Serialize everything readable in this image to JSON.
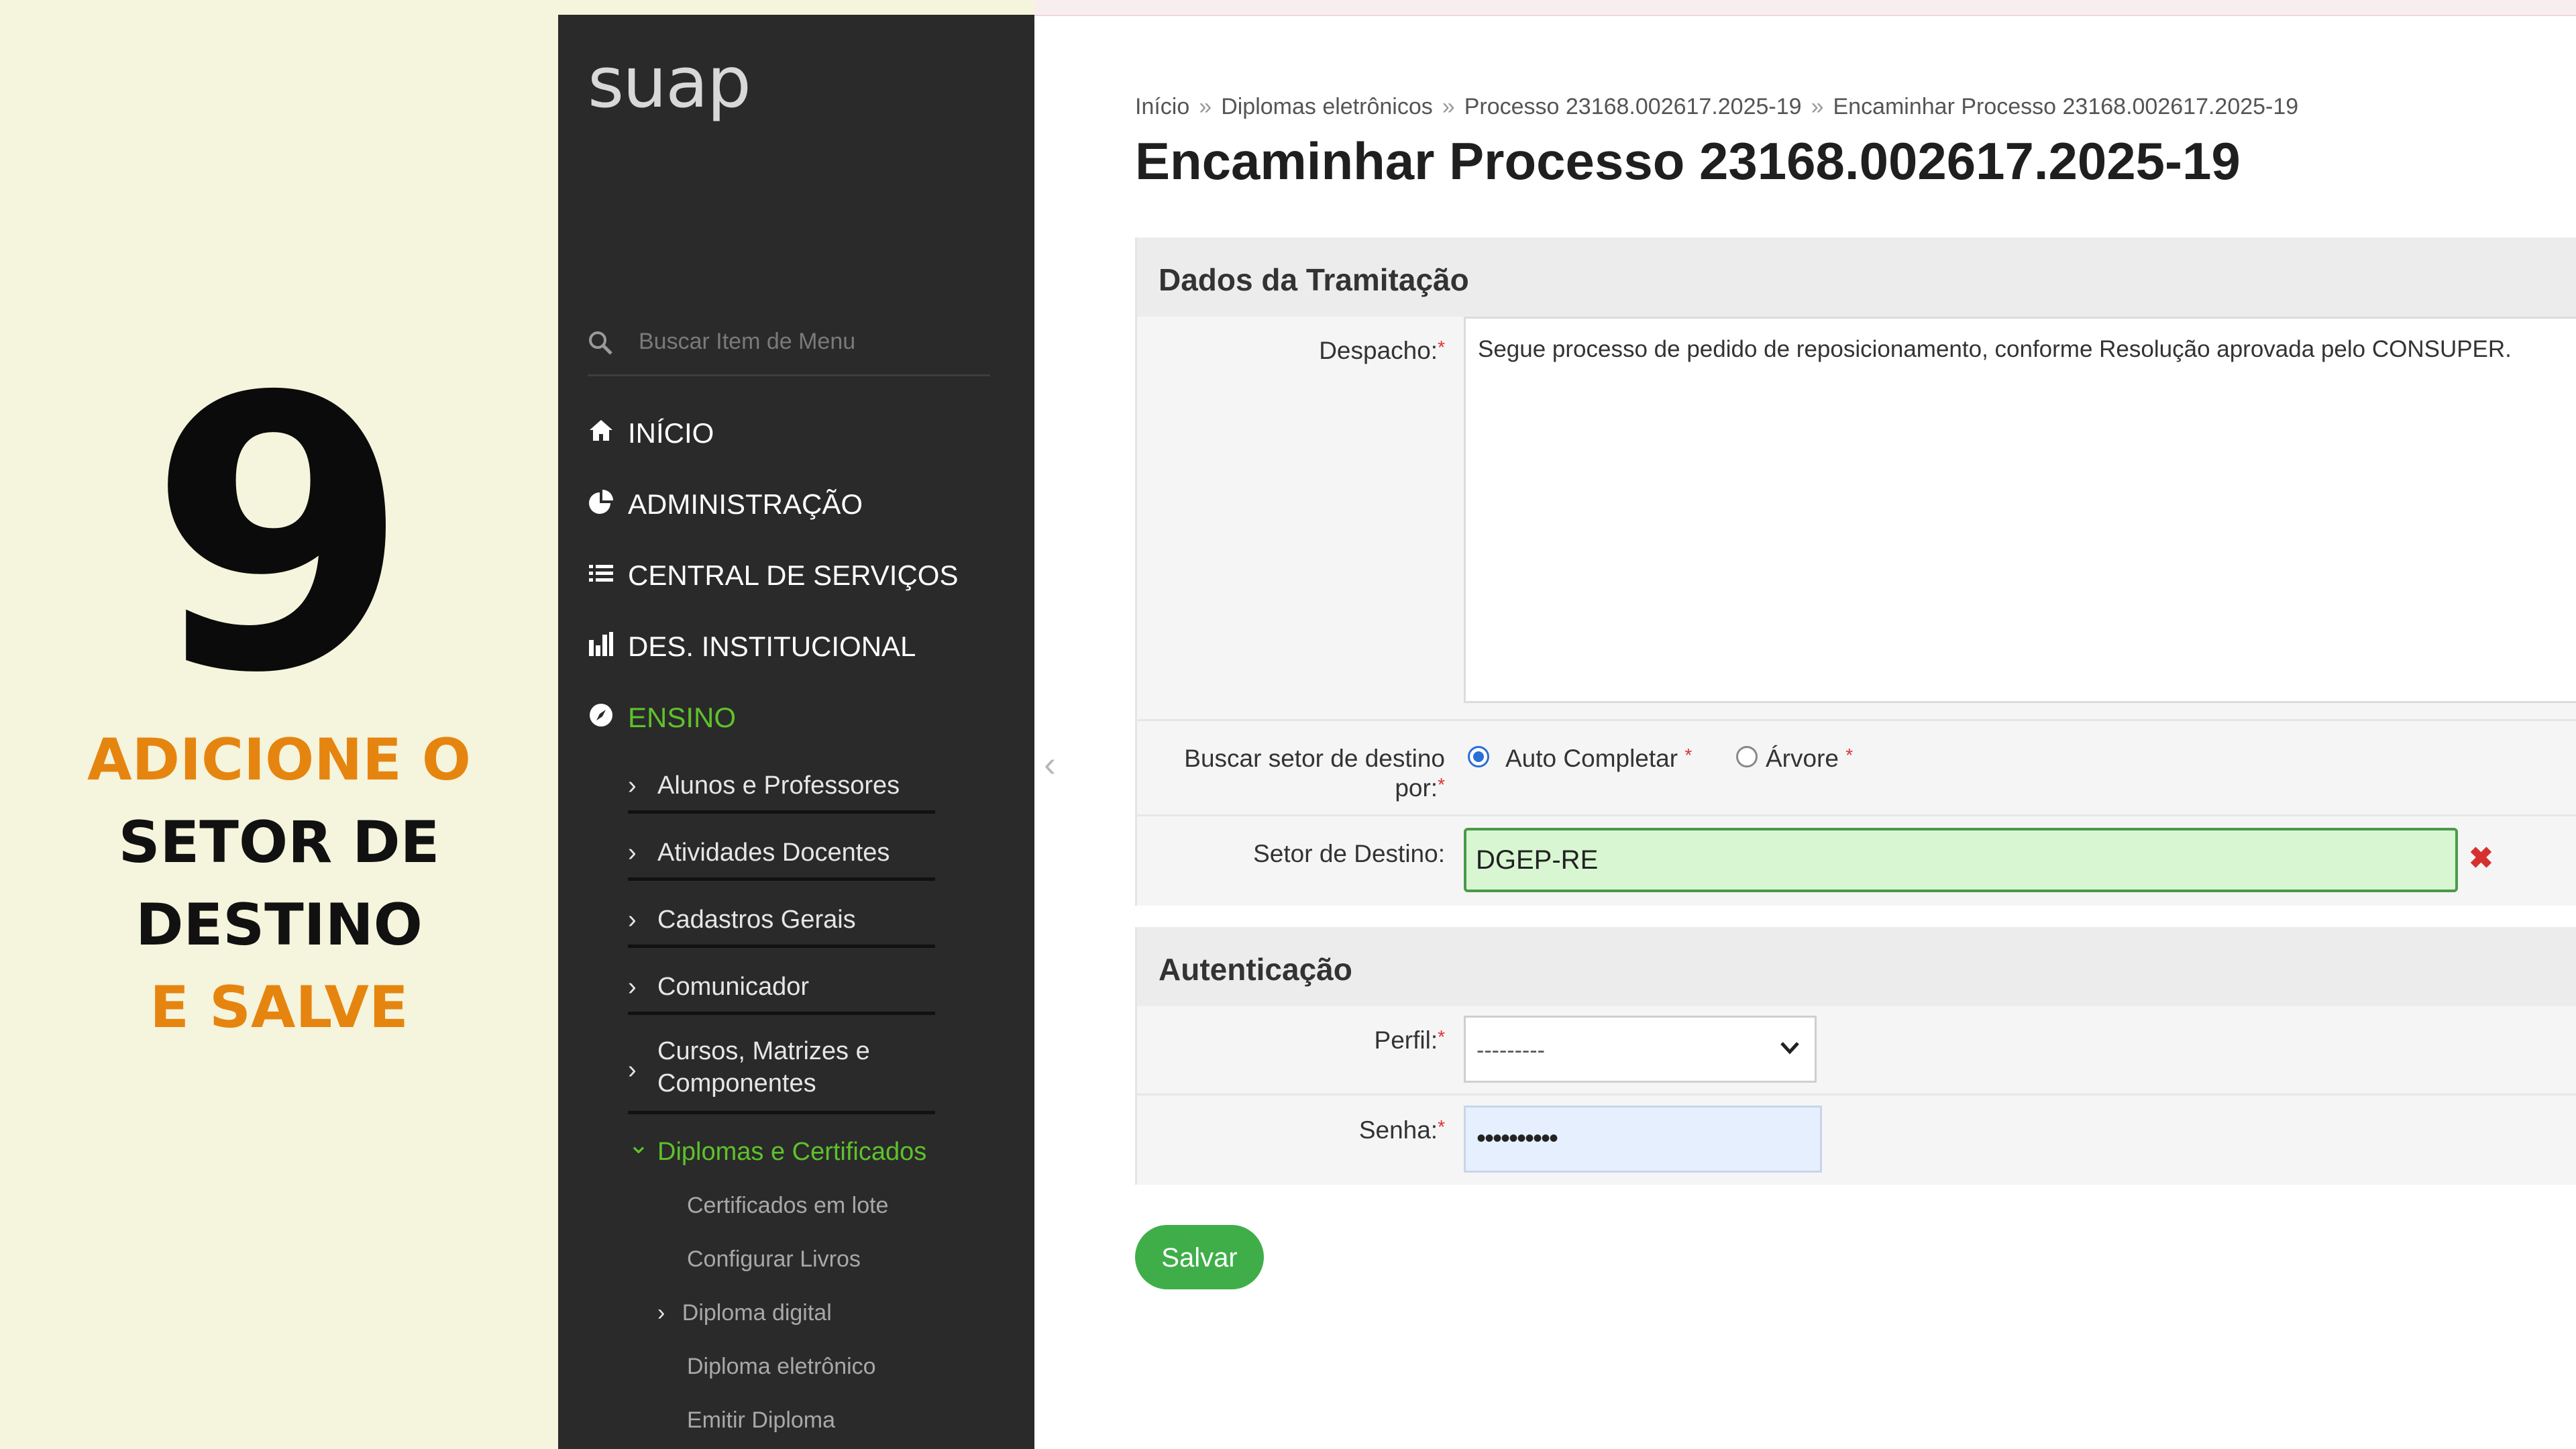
{
  "instruction": {
    "step_number": "9",
    "line1": "ADICIONE O",
    "line2": "SETOR DE",
    "line3": "DESTINO",
    "line4": "E SALVE"
  },
  "sidebar": {
    "logo": "suap",
    "search_placeholder": "Buscar Item de Menu",
    "main_items": [
      {
        "label": "INÍCIO",
        "icon": "home-icon"
      },
      {
        "label": "ADMINISTRAÇÃO",
        "icon": "pie-chart-icon"
      },
      {
        "label": "CENTRAL DE SERVIÇOS",
        "icon": "list-icon"
      },
      {
        "label": "DES. INSTITUCIONAL",
        "icon": "bar-chart-icon"
      },
      {
        "label": "ENSINO",
        "icon": "compass-icon",
        "active": true
      }
    ],
    "sub_items": [
      {
        "label": "Alunos e Professores",
        "chevron": "›"
      },
      {
        "label": "Atividades Docentes",
        "chevron": "›"
      },
      {
        "label": "Cadastros Gerais",
        "chevron": "›"
      },
      {
        "label": "Comunicador",
        "chevron": "›"
      },
      {
        "label_line1": "Cursos, Matrizes e",
        "label_line2": "Componentes",
        "chevron": "›"
      },
      {
        "label": "Diplomas e Certificados",
        "chevron": "⌄",
        "active": true
      }
    ],
    "subsub_items": [
      {
        "label": "Certificados em lote"
      },
      {
        "label": "Configurar Livros"
      },
      {
        "label": "Diploma digital",
        "chevron": "›"
      },
      {
        "label": "Diploma eletrônico",
        "active": true
      },
      {
        "label": "Emitir Diploma"
      }
    ],
    "colors": {
      "background": "#2a2a2a",
      "active": "#5ec22b"
    }
  },
  "breadcrumb": [
    "Início",
    "Diplomas eletrônicos",
    "Processo 23168.002617.2025-19",
    "Encaminhar Processo 23168.002617.2025-19"
  ],
  "breadcrumb_separator": "»",
  "page_title": "Encaminhar Processo 23168.002617.2025-19",
  "tramitacao": {
    "heading": "Dados da Tramitação",
    "despacho_label": "Despacho:",
    "despacho_value": "Segue processo de pedido de reposicionamento, conforme Resolução aprovada pelo CONSUPER.",
    "buscar_label_line1": "Buscar setor de destino",
    "buscar_label_line2": "por:",
    "radio_auto": "Auto Completar",
    "radio_arvore": "Árvore",
    "selected_radio": "Auto Completar",
    "setor_label": "Setor de Destino:",
    "setor_value": "DGEP-RE",
    "clear_symbol": "✖"
  },
  "autenticacao": {
    "heading": "Autenticação",
    "perfil_label": "Perfil:",
    "perfil_value": "---------",
    "senha_label": "Senha:",
    "senha_value": "••••••••••"
  },
  "required_marker": "*",
  "save_button": "Salvar",
  "collapse_arrow": "‹",
  "colors": {
    "accent_orange": "#e5850f",
    "save_green": "#3fae49",
    "input_valid": "#d8f6d2"
  }
}
